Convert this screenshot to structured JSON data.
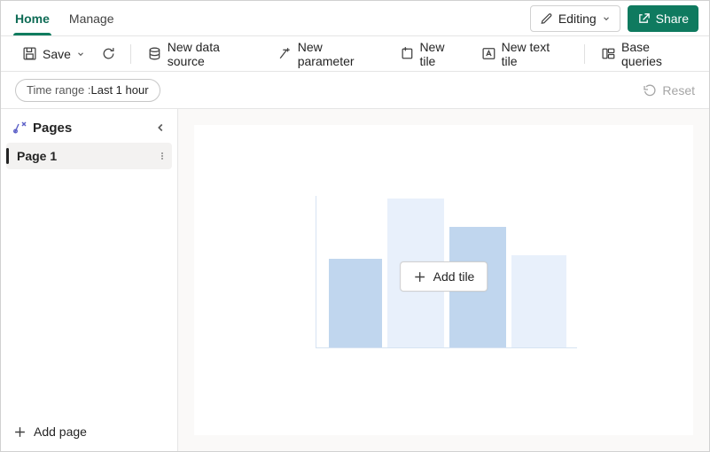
{
  "tabs": {
    "home": "Home",
    "manage": "Manage"
  },
  "top": {
    "editing": "Editing",
    "share": "Share"
  },
  "toolbar": {
    "save": "Save",
    "new_data_source": "New data source",
    "new_parameter": "New parameter",
    "new_tile": "New tile",
    "new_text_tile": "New text tile",
    "base_queries": "Base queries"
  },
  "filter": {
    "label": "Time range : ",
    "value": "Last 1 hour",
    "reset": "Reset"
  },
  "sidebar": {
    "title": "Pages",
    "page1": "Page 1",
    "add_page": "Add page"
  },
  "canvas": {
    "add_tile": "Add tile"
  }
}
